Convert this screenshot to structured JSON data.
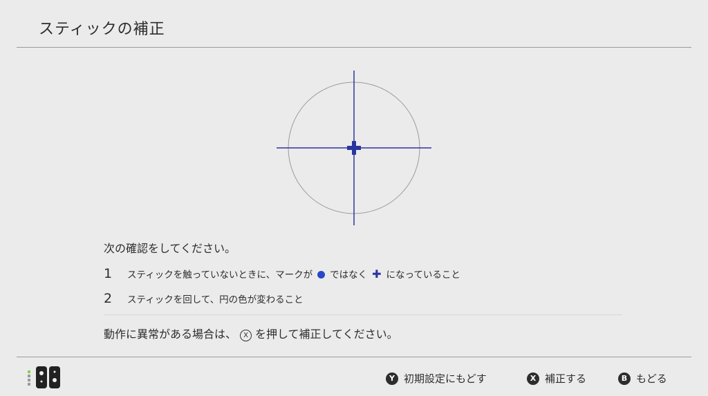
{
  "header": {
    "title": "スティックの補正"
  },
  "instructions": {
    "prompt": "次の確認をしてください。",
    "step1": {
      "number": "1",
      "before": "スティックを触っていないときに、マークが",
      "middle": "ではなく",
      "after": "になっていること"
    },
    "step2": {
      "number": "2",
      "text": "スティックを回して、円の色が変わること"
    }
  },
  "notice": {
    "before": "動作に異常がある場合は、",
    "button_glyph": "X",
    "after": "を押して補正してください。"
  },
  "footer": {
    "buttons": [
      {
        "glyph": "Y",
        "label": "初期設定にもどす"
      },
      {
        "glyph": "X",
        "label": "補正する"
      },
      {
        "glyph": "B",
        "label": "もどる"
      }
    ]
  },
  "colors": {
    "background": "#ebebeb",
    "accent_blue": "#2a36a0",
    "dot_blue": "#2a48c8",
    "led_green": "#7fd24a"
  },
  "icons": {
    "controller": "joy-con-pair-icon",
    "dot_marker": "blue-dot-icon",
    "plus_marker": "plus-icon"
  }
}
